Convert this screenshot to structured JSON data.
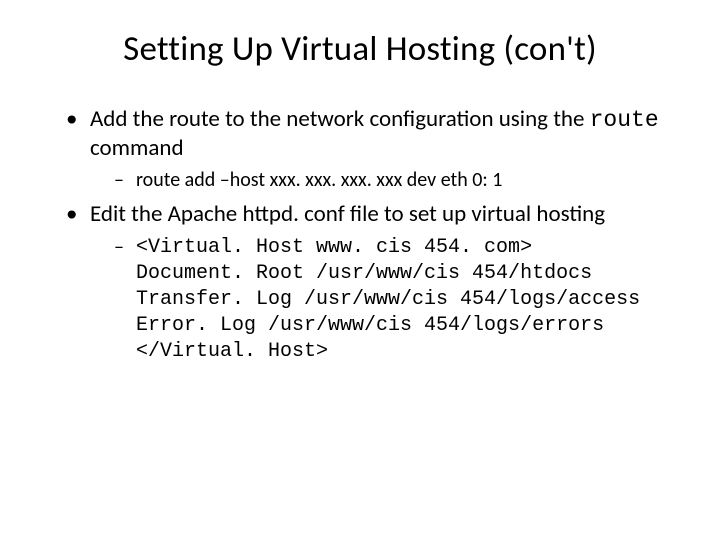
{
  "title": "Setting Up Virtual Hosting (con't)",
  "bullets": {
    "b1_pre": "Add the route to the network configuration using the ",
    "b1_code": "route",
    "b1_post": " command",
    "b1_sub": "route add –host xxx. xxx. xxx. xxx dev eth 0: 1",
    "b2": "Edit the Apache httpd. conf file to set up virtual hosting",
    "b2_code": "<Virtual. Host www. cis 454. com>\nDocument. Root /usr/www/cis 454/htdocs\nTransfer. Log /usr/www/cis 454/logs/access\nError. Log /usr/www/cis 454/logs/errors\n</Virtual. Host>"
  }
}
